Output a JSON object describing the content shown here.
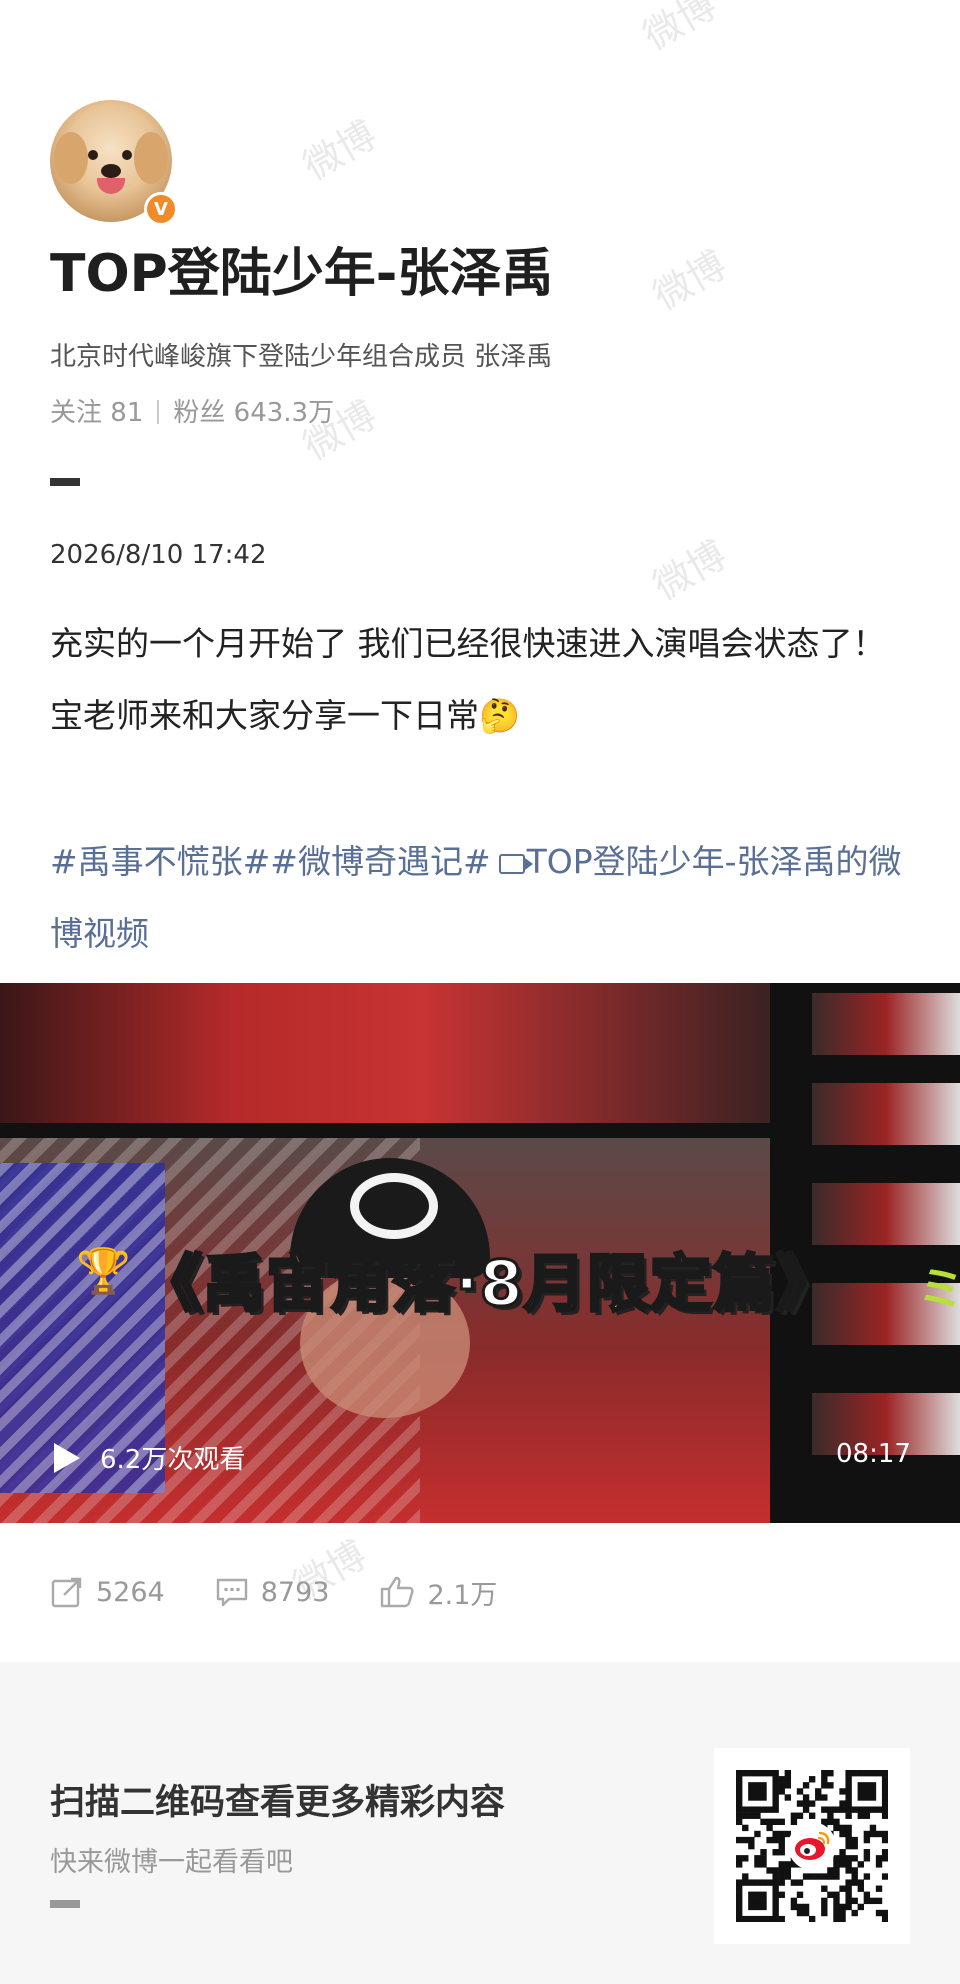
{
  "profile": {
    "username": "TOP登陆少年-张泽禹",
    "verified_badge": "V",
    "bio": "北京时代峰峻旗下登陆少年组合成员 张泽禹",
    "following_label": "关注",
    "following_count": "81",
    "followers_label": "粉丝",
    "followers_count": "643.3万"
  },
  "post": {
    "time": "2026/8/10 17:42",
    "text": "充实的一个月开始了 我们已经很快速进入演唱会状态了！宝老师来和大家分享一下日常🤔",
    "tags_text": "#禹事不慌张##微博奇遇记#",
    "video_link_text": "TOP登陆少年-张泽禹的微博视频"
  },
  "video": {
    "title_overlay": "《禹宙角落·8月限定篇》",
    "view_count": "6.2万次观看",
    "duration": "08:17"
  },
  "actions": {
    "reposts": "5264",
    "comments": "8793",
    "likes": "2.1万"
  },
  "footer": {
    "title": "扫描二维码查看更多精彩内容",
    "subtitle": "快来微博一起看看吧"
  },
  "watermark": "微博",
  "colors": {
    "link": "#5a6f96",
    "badge": "#f08a2a",
    "footer_bg": "#f6f6f6"
  }
}
